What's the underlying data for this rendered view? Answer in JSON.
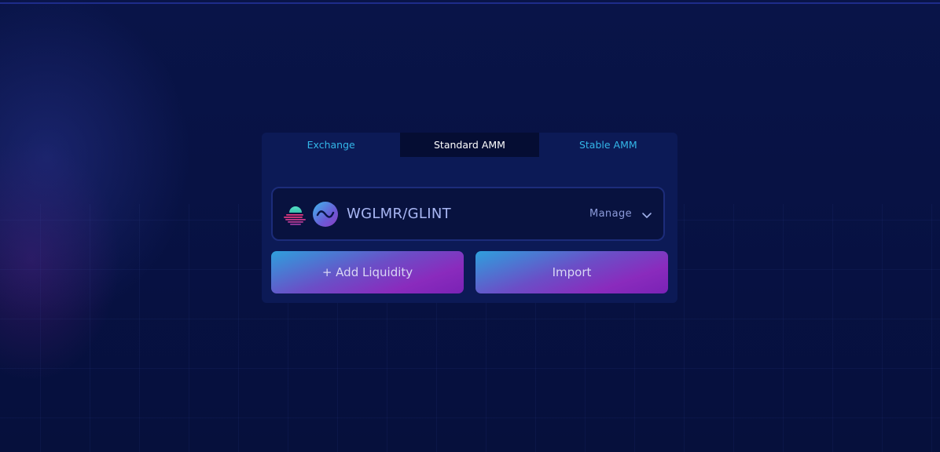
{
  "tabs": [
    {
      "label": "Exchange",
      "active": false
    },
    {
      "label": "Standard AMM",
      "active": true
    },
    {
      "label": "Stable AMM",
      "active": false
    }
  ],
  "pair": {
    "name": "WGLMR/GLINT",
    "token_icons": [
      "wglmr-token-icon",
      "glint-token-icon"
    ],
    "manage_label": "Manage",
    "manage_icon": "chevron-down-icon"
  },
  "actions": {
    "add_liquidity_label": "+ Add Liquidity",
    "import_label": "Import"
  },
  "colors": {
    "background": "#07113f",
    "card": "#0c1a56",
    "tab_text": "#33b6e8",
    "active_tab_bg": "#050d33",
    "button_gradient_start": "#2ea0dd",
    "button_gradient_end": "#8a2bbd"
  }
}
